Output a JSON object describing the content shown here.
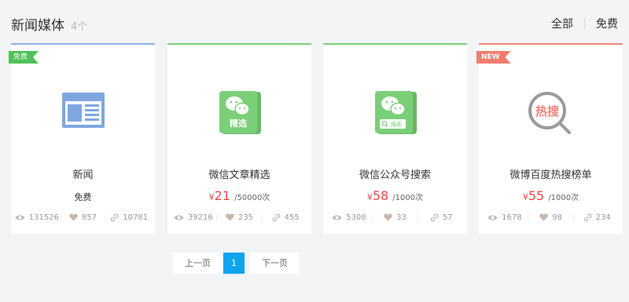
{
  "header": {
    "title": "新闻媒体",
    "count": "4个"
  },
  "filters": {
    "all": "全部",
    "free": "免费"
  },
  "cards": [
    {
      "ribbon": "免费",
      "name": "新闻",
      "price_label": "免费",
      "views": "131526",
      "likes": "857",
      "links": "10781",
      "icon": "newspaper-icon"
    },
    {
      "name": "微信文章精选",
      "price_symbol": "¥",
      "price": "21",
      "price_unit": "/50000次",
      "views": "39216",
      "likes": "235",
      "links": "455",
      "icon": "wechat-featured-icon",
      "icon_text": "精选"
    },
    {
      "name": "微信公众号搜索",
      "price_symbol": "¥",
      "price": "58",
      "price_unit": "/1000次",
      "views": "5308",
      "likes": "33",
      "links": "57",
      "icon": "wechat-search-icon",
      "icon_text": "搜索"
    },
    {
      "ribbon": "NEW",
      "name": "微博百度热搜榜单",
      "price_symbol": "¥",
      "price": "55",
      "price_unit": "/1000次",
      "views": "1678",
      "likes": "98",
      "links": "234",
      "icon": "hot-search-icon",
      "icon_text": "热搜"
    }
  ],
  "pagination": {
    "prev": "上一页",
    "current": "1",
    "next": "下一页"
  },
  "colors": {
    "accent_blue": "#0fa4f0",
    "price_red": "#f04a4a",
    "green": "#7bcf79",
    "red": "#f1857b",
    "blue": "#8eb2e4"
  }
}
